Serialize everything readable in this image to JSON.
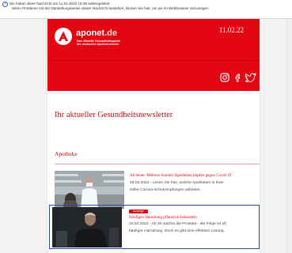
{
  "notice": {
    "line1": "Sie haben diese Nachricht am 11.02.2022 15:26 weitergeleitet.",
    "line2": "Wenn Probleme mit der Darstellungsweise dieser Nachricht bestehen, klicken Sie hier, um sie im Webbrowser anzuzeigen.",
    "icon": "info-icon"
  },
  "header": {
    "brand_main": "aponet",
    "brand_tld": ".de",
    "tagline_line1": "Das offizielle Gesundheitsportal",
    "tagline_line2": "der deutschen Apothekerinnen",
    "date": "11.02.22",
    "brand_color": "#e30613",
    "social_icons": [
      "instagram-icon",
      "facebook-icon",
      "twitter-icon"
    ]
  },
  "intro": {
    "title": "Ihr aktueller Gesundheitsnewsletter"
  },
  "section": {
    "title": "Apotheke"
  },
  "articles": [
    {
      "title": "Ab heute: Mehrere hundert Apotheken impfen gegen Covid-19",
      "text_line1": "08.02.2022 - Lesen Sie hier, welche Apotheken in Ihrer",
      "text_line2": "Nähe Corona-Schutzimpfungen anbieten."
    },
    {
      "badge": "Anzeige",
      "title": "Häufigen Harndrang pflanzlich behandeln",
      "text_line1": "10.02.2022 - Ab 30 wächst die Prostata - die Folge ist oft",
      "text_line2": "häufiger Harndrang. Doch es gibt eine effektive Lösung."
    }
  ]
}
